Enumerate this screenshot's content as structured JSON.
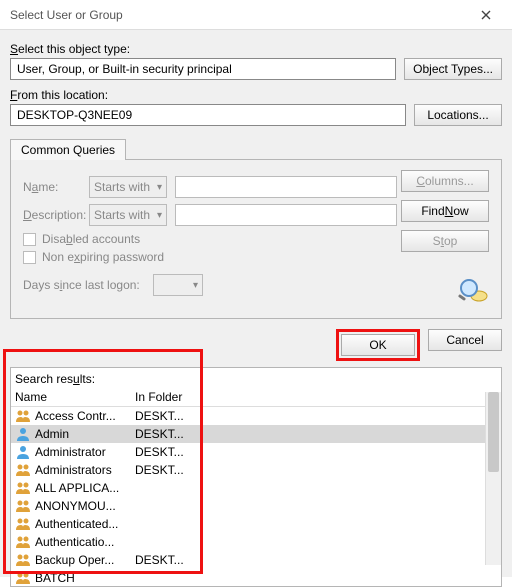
{
  "title": "Select User or Group",
  "labels": {
    "objectType": "Select this object type:",
    "fromLocation": "From this location:",
    "commonQueries": "Common Queries",
    "name": "Name:",
    "description": "Description:",
    "startsWith": "Starts with",
    "disabledAccounts": "Disabled accounts",
    "nonExpiring": "Non expiring password",
    "daysSince": "Days since last logon:",
    "searchResults": "Search results:",
    "colName": "Name",
    "colFolder": "In Folder"
  },
  "fields": {
    "objectType": "User, Group, or Built-in security principal",
    "location": "DESKTOP-Q3NEE09"
  },
  "buttons": {
    "objectTypes": "Object Types...",
    "locations": "Locations...",
    "columns": "Columns...",
    "findNow": "Find Now",
    "stop": "Stop",
    "ok": "OK",
    "cancel": "Cancel"
  },
  "results": [
    {
      "name": "Access Contr...",
      "folder": "DESKT...",
      "icon": "group"
    },
    {
      "name": "Admin",
      "folder": "DESKT...",
      "icon": "user",
      "selected": true
    },
    {
      "name": "Administrator",
      "folder": "DESKT...",
      "icon": "user"
    },
    {
      "name": "Administrators",
      "folder": "DESKT...",
      "icon": "group"
    },
    {
      "name": "ALL APPLICA...",
      "folder": "",
      "icon": "group"
    },
    {
      "name": "ANONYMOU...",
      "folder": "",
      "icon": "group"
    },
    {
      "name": "Authenticated...",
      "folder": "",
      "icon": "group"
    },
    {
      "name": "Authenticatio...",
      "folder": "",
      "icon": "group"
    },
    {
      "name": "Backup Oper...",
      "folder": "DESKT...",
      "icon": "group"
    },
    {
      "name": "BATCH",
      "folder": "",
      "icon": "group"
    }
  ]
}
